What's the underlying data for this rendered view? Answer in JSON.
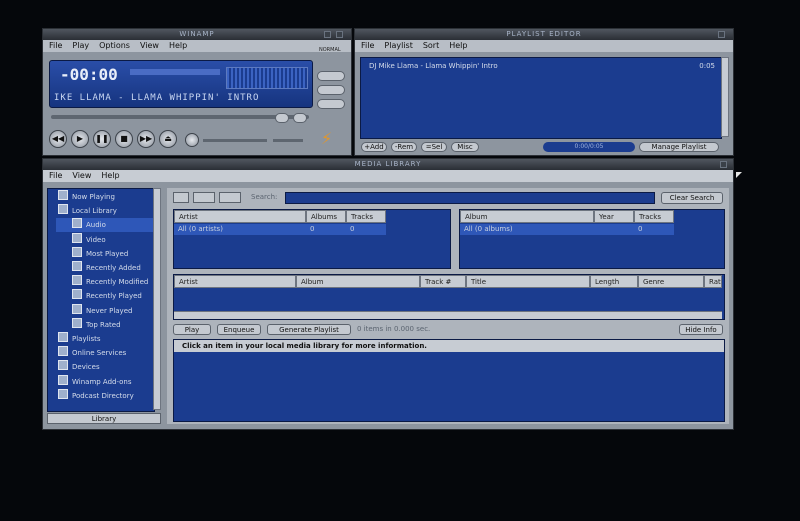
{
  "player": {
    "title": "WINAMP",
    "menu": [
      "File",
      "Play",
      "Options",
      "View",
      "Help"
    ],
    "time": "-00:00",
    "marquee": "IKE LLAMA - LLAMA WHIPPIN' INTRO",
    "side_labels": [
      "NORMAL"
    ],
    "transport": [
      "◀◀",
      "▶",
      "❚❚",
      "■",
      "▶▶",
      "⏏"
    ]
  },
  "playlist": {
    "title": "PLAYLIST EDITOR",
    "menu": [
      "File",
      "Playlist",
      "Sort",
      "Help"
    ],
    "entries": [
      {
        "name": "DJ Mike Llama - Llama Whippin' Intro",
        "length": "0:05"
      }
    ],
    "buttons": [
      "+Add",
      "-Rem",
      "=Sel",
      "Misc"
    ],
    "counter": "0:00/0:05",
    "manage": "Manage Playlist"
  },
  "library": {
    "title": "MEDIA LIBRARY",
    "menu": [
      "File",
      "View",
      "Help"
    ],
    "tree": [
      {
        "label": "Now Playing",
        "indent": 0,
        "icon": "now-playing-icon"
      },
      {
        "label": "Local Library",
        "indent": 0,
        "icon": "local-library-icon"
      },
      {
        "label": "Audio",
        "indent": 1,
        "icon": "audio-icon",
        "selected": true
      },
      {
        "label": "Video",
        "indent": 1,
        "icon": "video-icon"
      },
      {
        "label": "Most Played",
        "indent": 1,
        "icon": "most-played-icon"
      },
      {
        "label": "Recently Added",
        "indent": 1,
        "icon": "recently-added-icon"
      },
      {
        "label": "Recently Modified",
        "indent": 1,
        "icon": "recently-modified-icon"
      },
      {
        "label": "Recently Played",
        "indent": 1,
        "icon": "recently-played-icon"
      },
      {
        "label": "Never Played",
        "indent": 1,
        "icon": "never-played-icon"
      },
      {
        "label": "Top Rated",
        "indent": 1,
        "icon": "top-rated-icon"
      },
      {
        "label": "Playlists",
        "indent": 0,
        "icon": "playlists-icon"
      },
      {
        "label": "Online Services",
        "indent": 0,
        "icon": "online-services-icon"
      },
      {
        "label": "Devices",
        "indent": 0,
        "icon": "devices-icon"
      },
      {
        "label": "Winamp Add-ons",
        "indent": 0,
        "icon": "addons-icon"
      },
      {
        "label": "Podcast Directory",
        "indent": 0,
        "icon": "podcast-icon"
      }
    ],
    "library_button": "Library",
    "search_label": "Search:",
    "clear_search": "Clear Search",
    "artist_table": {
      "headers": [
        "Artist",
        "Albums",
        "Tracks"
      ],
      "rows": [
        [
          "All (0 artists)",
          "0",
          "0"
        ]
      ]
    },
    "album_table": {
      "headers": [
        "Album",
        "Year",
        "Tracks"
      ],
      "rows": [
        [
          "All (0 albums)",
          "",
          "0"
        ]
      ]
    },
    "track_headers": [
      "Artist",
      "Album",
      "Track #",
      "Title",
      "Length",
      "Genre",
      "Rating"
    ],
    "bottom_buttons": [
      "Play",
      "Enqueue",
      "Generate Playlist"
    ],
    "items_status": "0 items in 0.000 sec.",
    "hide_info": "Hide Info",
    "info_text": "Click an item in your local media library for more information."
  }
}
